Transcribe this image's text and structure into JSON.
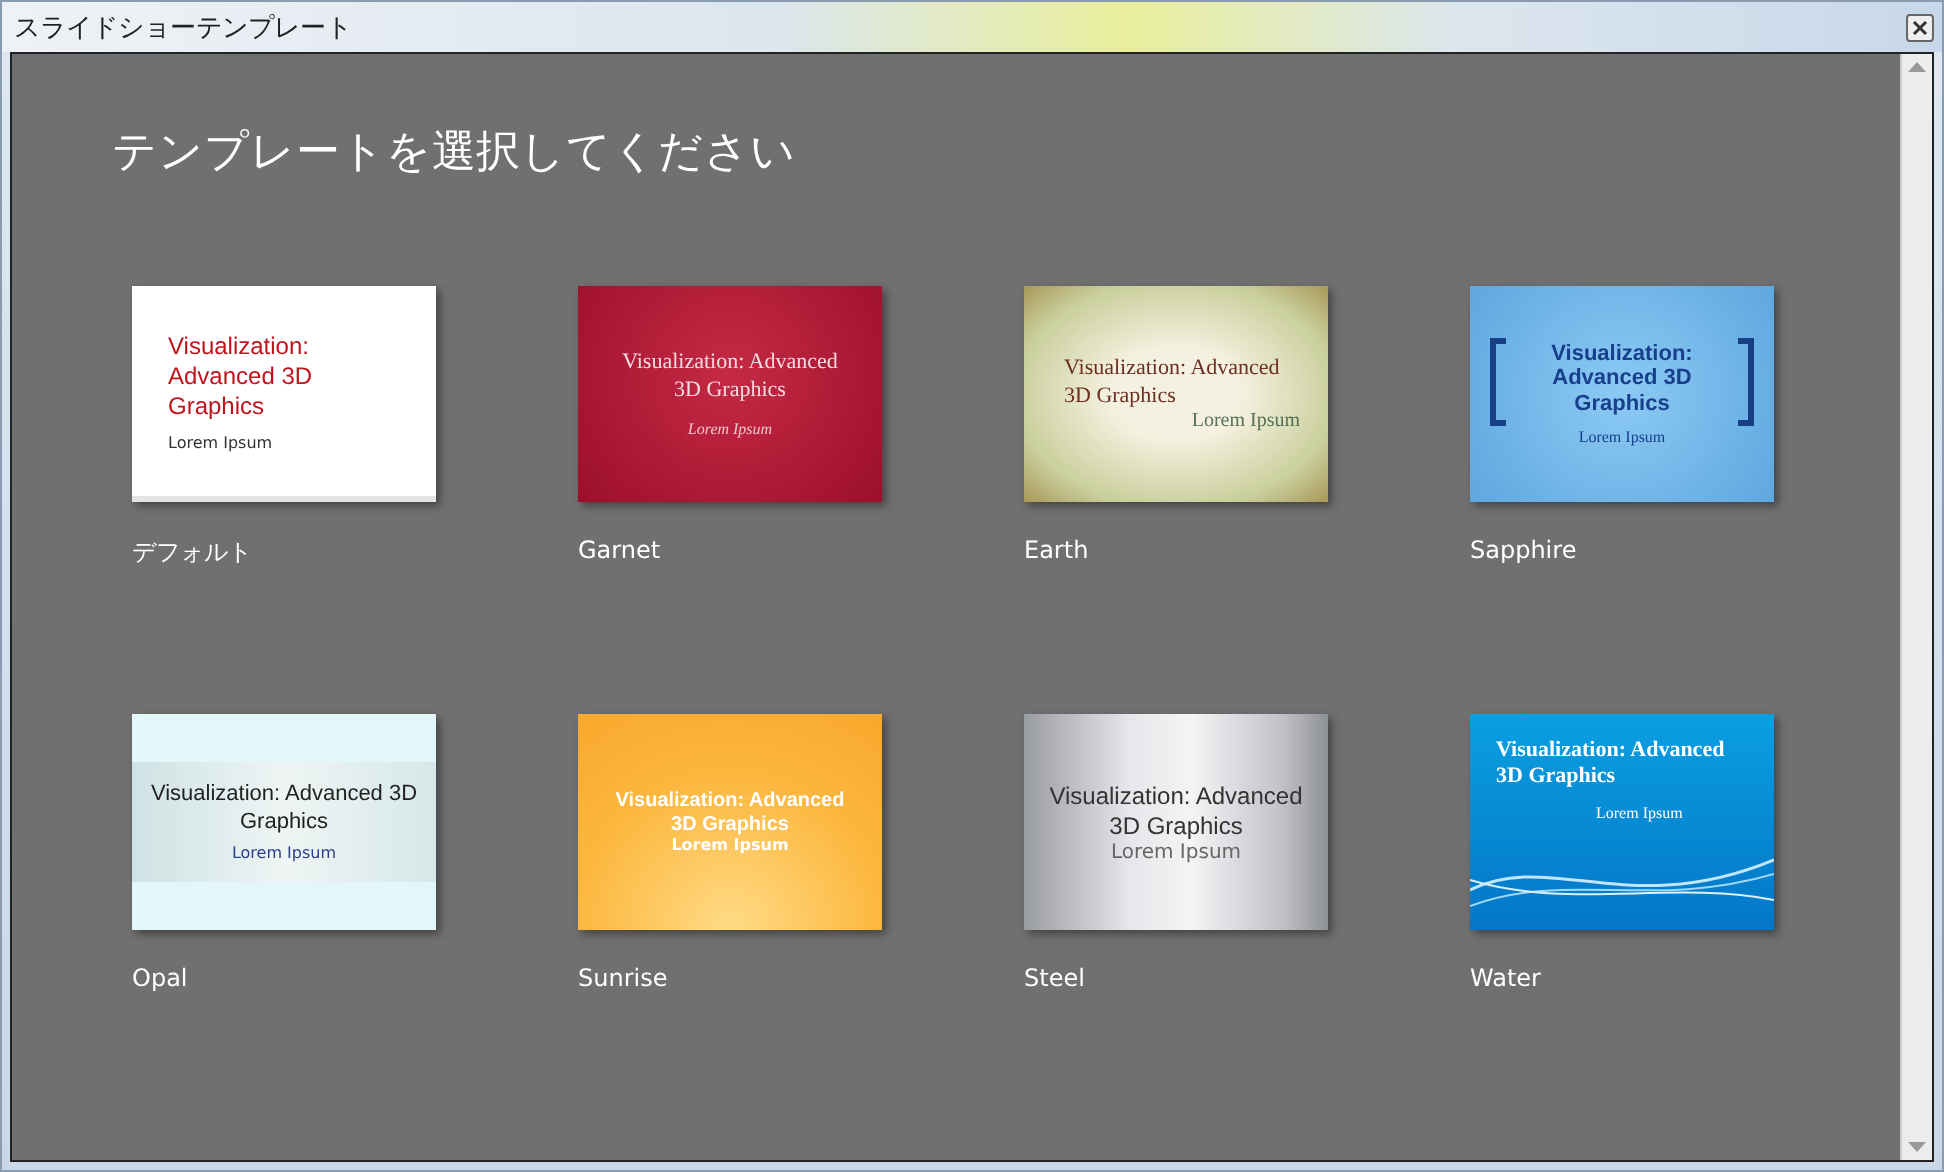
{
  "window": {
    "title": "スライドショーテンプレート"
  },
  "heading": "テンプレートを選択してください",
  "templates": [
    {
      "name": "デフォルト",
      "kind": "default",
      "slide_title": "Visualization: Advanced 3D Graphics",
      "slide_subtitle": "Lorem Ipsum"
    },
    {
      "name": "Garnet",
      "kind": "garnet",
      "slide_title": "Visualization: Advanced 3D Graphics",
      "slide_subtitle": "Lorem Ipsum"
    },
    {
      "name": "Earth",
      "kind": "earth",
      "slide_title": "Visualization: Advanced 3D Graphics",
      "slide_subtitle": "Lorem Ipsum"
    },
    {
      "name": "Sapphire",
      "kind": "sapphire",
      "slide_title": "Visualization: Advanced 3D Graphics",
      "slide_subtitle": "Lorem Ipsum"
    },
    {
      "name": "Opal",
      "kind": "opal",
      "slide_title": "Visualization: Advanced 3D Graphics",
      "slide_subtitle": "Lorem Ipsum"
    },
    {
      "name": "Sunrise",
      "kind": "sunrise",
      "slide_title": "Visualization: Advanced 3D Graphics",
      "slide_subtitle": "Lorem Ipsum"
    },
    {
      "name": "Steel",
      "kind": "steel",
      "slide_title": "Visualization: Advanced 3D Graphics",
      "slide_subtitle": "Lorem Ipsum"
    },
    {
      "name": "Water",
      "kind": "water",
      "slide_title": "Visualization: Advanced 3D Graphics",
      "slide_subtitle": "Lorem Ipsum"
    }
  ]
}
